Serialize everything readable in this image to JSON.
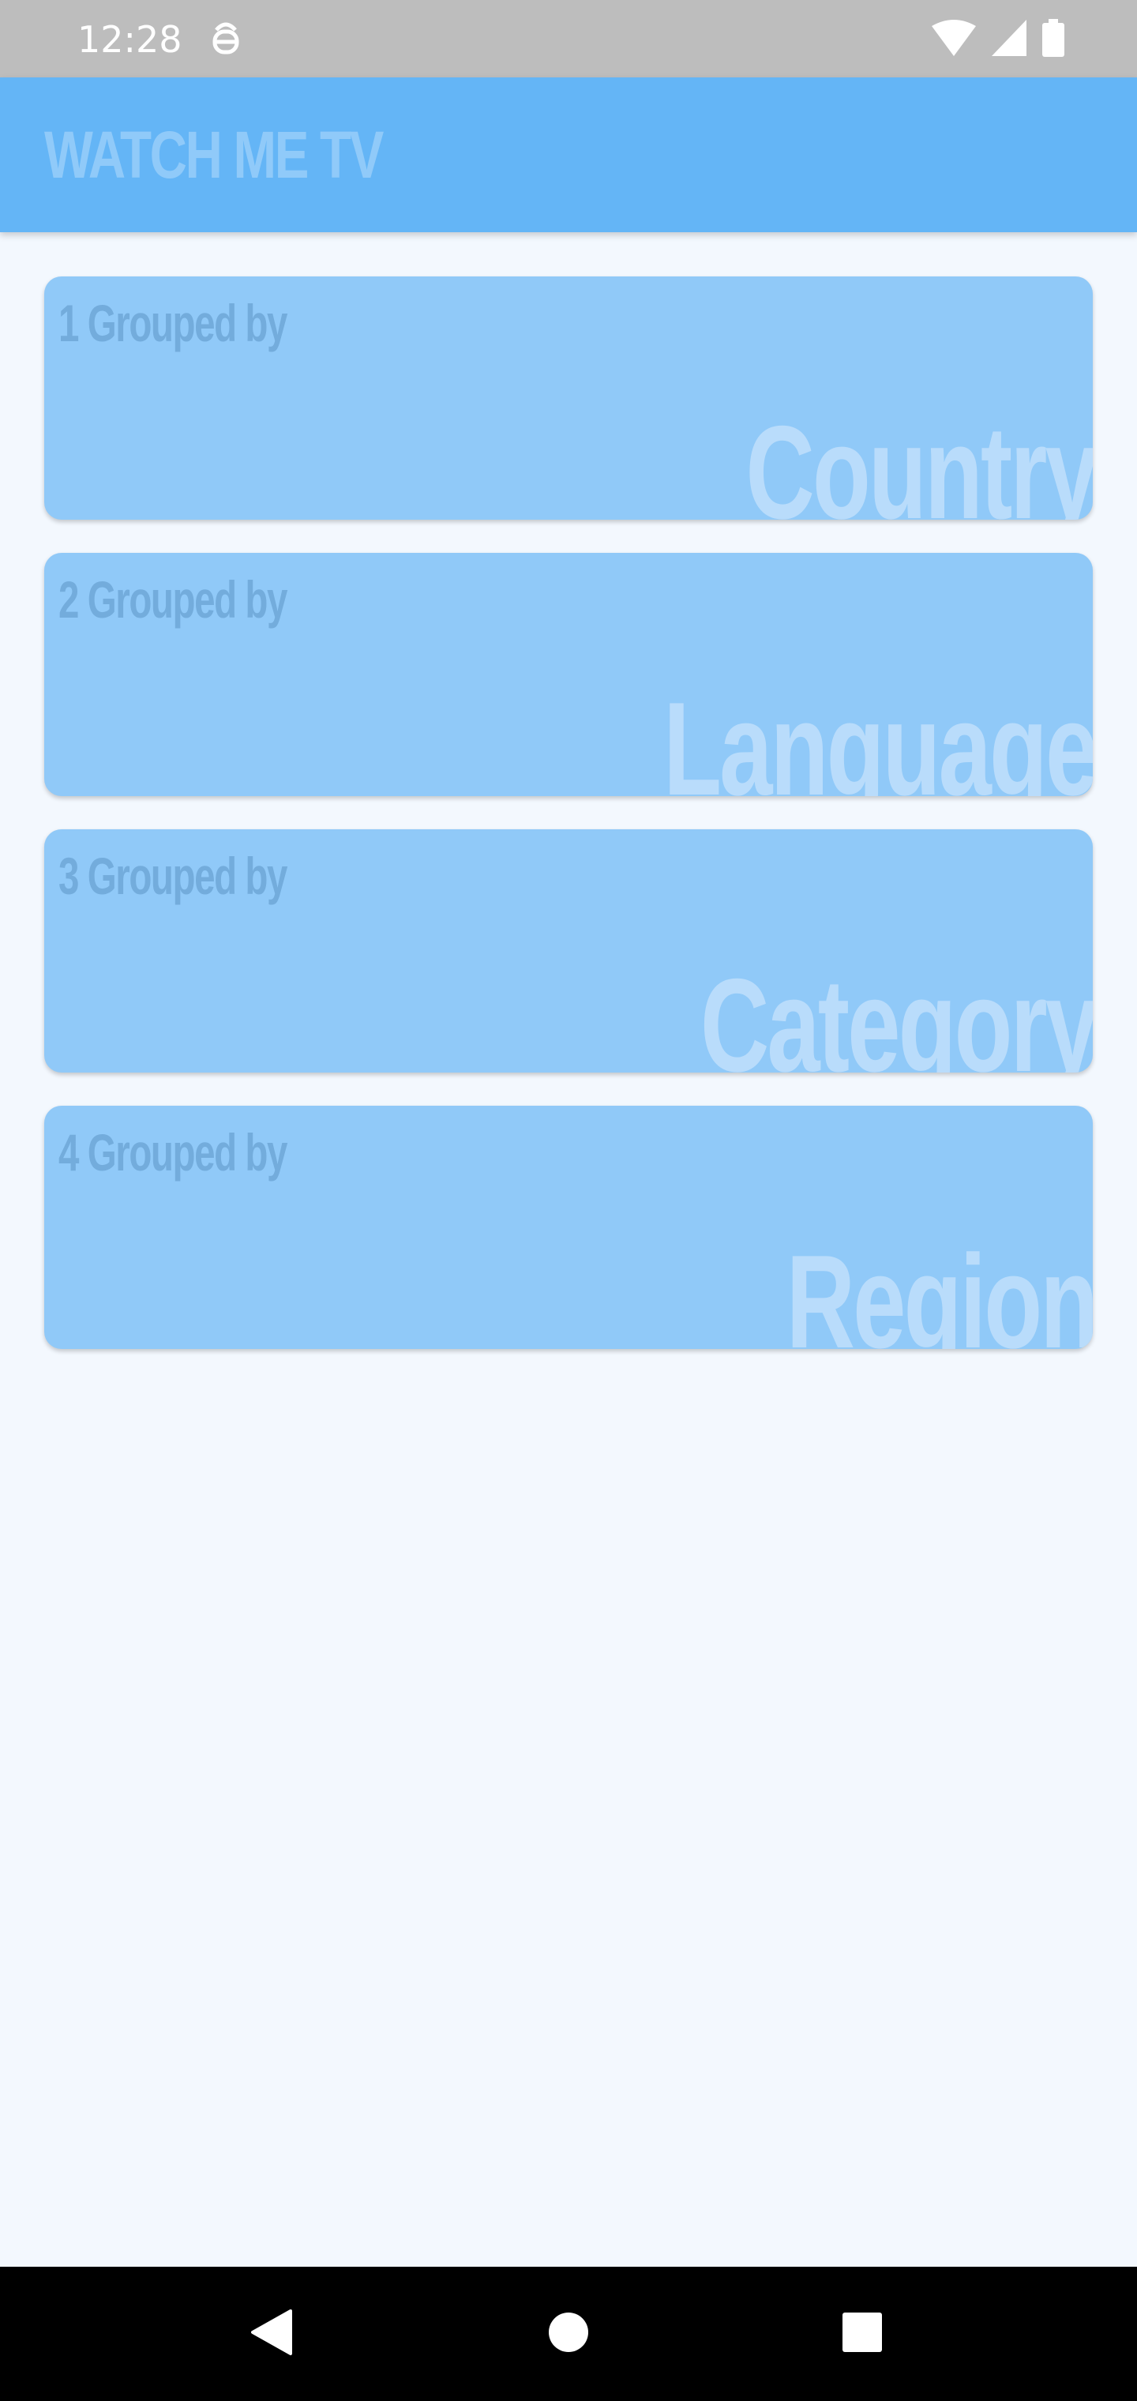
{
  "status_bar": {
    "time": "12:28",
    "icons": [
      "notification-icon",
      "wifi-icon",
      "signal-icon",
      "battery-icon"
    ]
  },
  "app_bar": {
    "title": "WATCH ME TV"
  },
  "groups": [
    {
      "subtitle": "1 Grouped by",
      "label": "Country"
    },
    {
      "subtitle": "2 Grouped by",
      "label": "Language"
    },
    {
      "subtitle": "3 Grouped by",
      "label": "Category"
    },
    {
      "subtitle": "4 Grouped by",
      "label": "Region"
    }
  ],
  "nav_bar": {
    "icons": [
      "back-icon",
      "home-icon",
      "recents-icon"
    ]
  },
  "colors": {
    "app_bar": "#64B5F6",
    "card": "#90C9F8",
    "background": "#F3F8FE"
  }
}
